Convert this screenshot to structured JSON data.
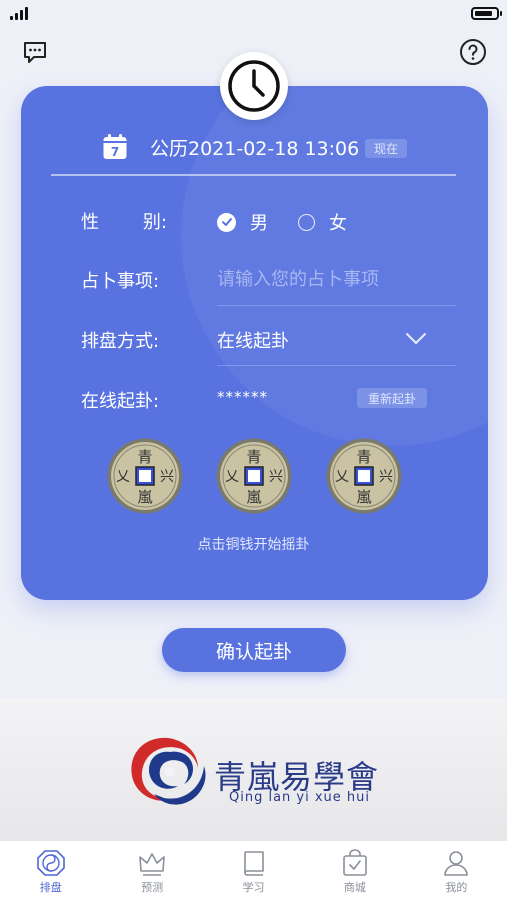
{
  "status_bar": {
    "signal_icon": "signal-bars-icon",
    "battery_icon": "battery-icon"
  },
  "top_icons": {
    "left": "chat-icon",
    "right": "help-icon"
  },
  "clock_icon": "clock-icon",
  "form": {
    "date_icon_text": "7",
    "date_text": "公历2021-02-18 13:06",
    "now_label": "现在",
    "gender_label_a": "性",
    "gender_label_b": "别:",
    "gender_options": [
      "男",
      "女"
    ],
    "gender_selected": "男",
    "matter_label": "占卜事项:",
    "matter_value": "",
    "matter_placeholder": "请输入您的占卜事项",
    "method_label": "排盘方式:",
    "method_value": "在线起卦",
    "online_label": "在线起卦:",
    "online_value": "******",
    "rethrow_label": "重新起卦",
    "coin_chars": {
      "top": "青",
      "right": "兴",
      "bottom": "嵐",
      "left": "乂"
    },
    "coin_hint": "点击铜钱开始摇卦"
  },
  "confirm_label": "确认起卦",
  "banner": {
    "brand_cn": "青嵐易學會",
    "brand_en": "Qing lan yi xue hui"
  },
  "tabs": [
    {
      "label": "排盘",
      "icon": "paipan-icon",
      "active": true
    },
    {
      "label": "预测",
      "icon": "crown-icon",
      "active": false
    },
    {
      "label": "学习",
      "icon": "book-icon",
      "active": false
    },
    {
      "label": "商城",
      "icon": "shopping-bag-icon",
      "active": false
    },
    {
      "label": "我的",
      "icon": "user-icon",
      "active": false
    }
  ],
  "colors": {
    "primary": "#5873e0",
    "background": "#eef0f8",
    "brand": "#2a3b88",
    "tab_active": "#4f67d6"
  }
}
